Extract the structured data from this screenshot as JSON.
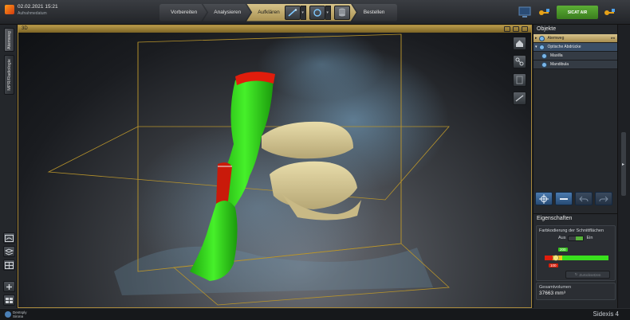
{
  "session": {
    "date": "02.02.2021 15:21",
    "subtitle": "Aufnahmedatum"
  },
  "workflow": {
    "steps": [
      "Vorbereiten",
      "Analysieren",
      "Aufklären",
      "Bestellen"
    ],
    "active": "Aufklären"
  },
  "header_badge": "SICAT AIR",
  "left_tabs": [
    "Atemweg",
    "MPR/Radiologie"
  ],
  "left_tools": [
    "panorama-icon",
    "slice-stack-icon",
    "layout-icon",
    "add-view-icon",
    "grid-view-icon"
  ],
  "viewport": {
    "label": "3D",
    "header_icons": [
      "screenshot-icon",
      "camera-icon",
      "maximize-icon"
    ],
    "tools": [
      "home-view-icon",
      "structure-icon",
      "volume-icon",
      "measure-icon"
    ]
  },
  "objects_panel": {
    "title": "Objekte",
    "items": [
      {
        "label": "Atemweg",
        "level": 0,
        "selected": true
      },
      {
        "label": "Optische Abdrücke",
        "level": 0,
        "selected": false
      },
      {
        "label": "Maxilla",
        "level": 1,
        "selected": false
      },
      {
        "label": "Mandibula",
        "level": 1,
        "selected": false
      }
    ],
    "tools": [
      "focus-icon",
      "remove-icon",
      "undo-icon",
      "redo-icon"
    ]
  },
  "properties": {
    "title": "Eigenschaften",
    "color_coding_title": "Farbkodierung der Schnittflächen",
    "toggle_off": "Aus",
    "toggle_on": "Ein",
    "marker_high": "200",
    "marker_low": "100",
    "reset_label": "Zurücksetzen",
    "volume_label": "Gesamtvolumen",
    "volume_value": "37663 mm³"
  },
  "status": {
    "vendor_line1": "Dentsply",
    "vendor_line2": "Sirona",
    "app_name": "Sidexis 4"
  },
  "colors": {
    "accent_gold": "#b89a4a",
    "airway_green": "#2fd11a",
    "airway_red": "#d8200c",
    "teeth": "#d9cb9a",
    "select_blue": "#4b7bb0"
  }
}
